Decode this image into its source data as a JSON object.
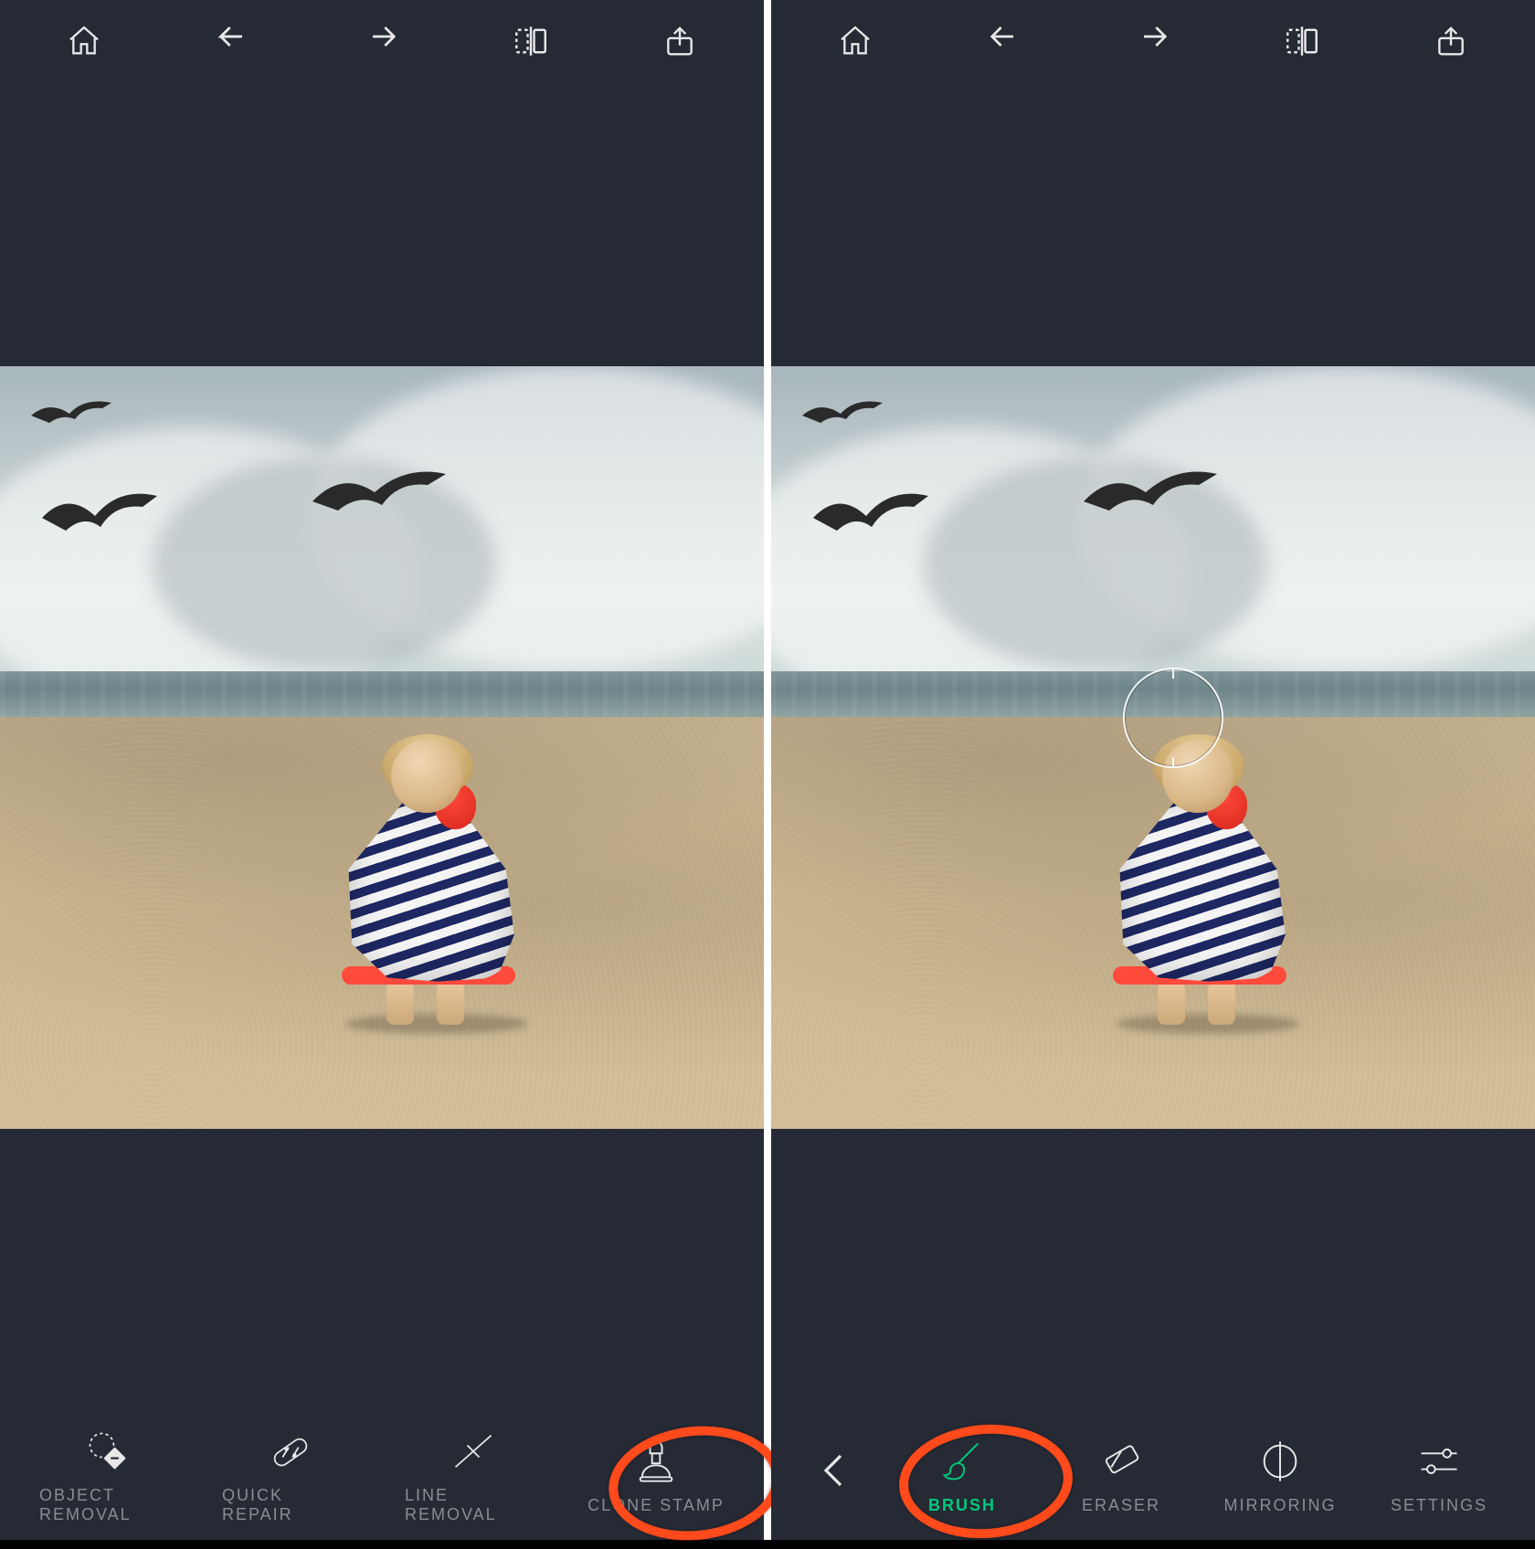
{
  "colors": {
    "accent": "#00c97b",
    "highlight": "#ff4a1c",
    "bg": "#252a35"
  },
  "left": {
    "topbar": {
      "home": "home-icon",
      "undo": "undo-icon",
      "redo": "redo-icon",
      "compare": "compare-icon",
      "share": "share-icon"
    },
    "tools": [
      {
        "id": "object-removal",
        "label": "OBJECT REMOVAL",
        "icon": "object-removal-icon",
        "active": false,
        "highlighted": false
      },
      {
        "id": "quick-repair",
        "label": "QUICK REPAIR",
        "icon": "quick-repair-icon",
        "active": false,
        "highlighted": false
      },
      {
        "id": "line-removal",
        "label": "LINE REMOVAL",
        "icon": "line-removal-icon",
        "active": false,
        "highlighted": false
      },
      {
        "id": "clone-stamp",
        "label": "CLONE STAMP",
        "icon": "clone-stamp-icon",
        "active": false,
        "highlighted": true
      }
    ]
  },
  "right": {
    "topbar": {
      "home": "home-icon",
      "undo": "undo-icon",
      "redo": "redo-icon",
      "compare": "compare-icon",
      "share": "share-icon"
    },
    "reticle_visible": true,
    "tools": [
      {
        "id": "back",
        "label": "",
        "icon": "back-icon",
        "active": false,
        "highlighted": false
      },
      {
        "id": "brush",
        "label": "BRUSH",
        "icon": "brush-icon",
        "active": true,
        "highlighted": true
      },
      {
        "id": "eraser",
        "label": "ERASER",
        "icon": "eraser-icon",
        "active": false,
        "highlighted": false
      },
      {
        "id": "mirroring",
        "label": "MIRRORING",
        "icon": "mirroring-icon",
        "active": false,
        "highlighted": false
      },
      {
        "id": "settings",
        "label": "SETTINGS",
        "icon": "settings-icon",
        "active": false,
        "highlighted": false
      }
    ]
  }
}
